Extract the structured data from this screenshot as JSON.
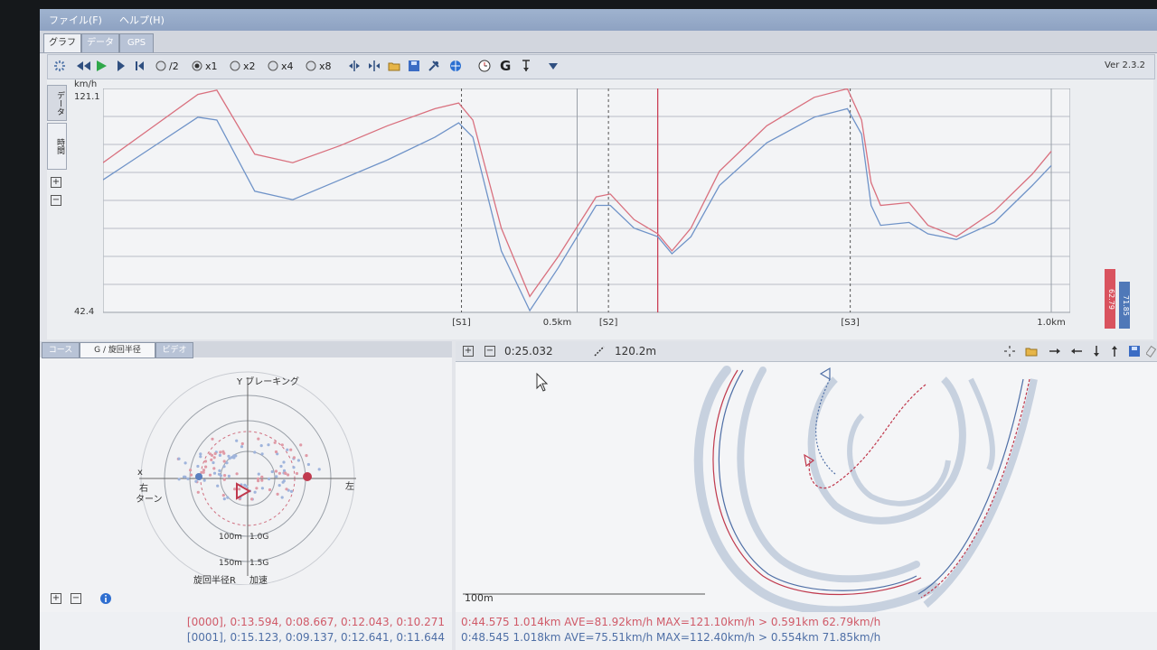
{
  "menu": {
    "file": "ファイル(F)",
    "help": "ヘルプ(H)"
  },
  "tabs": [
    "グラフ",
    "データ",
    "GPS"
  ],
  "toolbar": {
    "speed_half": "/2",
    "speed_x1": "x1",
    "speed_x2": "x2",
    "speed_x4": "x4",
    "speed_x8": "x8",
    "g_label": "G",
    "version": "Ver 2.3.2"
  },
  "graph": {
    "side_tabs": [
      "データ",
      "時間"
    ],
    "unit": "km/h",
    "y_max_label": "121.1",
    "y_min_label": "42.4"
  },
  "chart_data": {
    "type": "line",
    "ylabel": "km/h",
    "ylim": [
      42.4,
      121.1
    ],
    "xlim": [
      0,
      1.02
    ],
    "x_tick_labels": [
      {
        "x": 0.5,
        "label": "0.5km"
      },
      {
        "x": 1.0,
        "label": "1.0km"
      }
    ],
    "sector_markers": [
      {
        "x": 0.378,
        "label": "[S1]"
      },
      {
        "x": 0.533,
        "label": "[S2]"
      },
      {
        "x": 0.788,
        "label": "[S3]"
      }
    ],
    "cursor_x": 0.585,
    "series": [
      {
        "color": "#d9707e",
        "x": [
          0,
          0.05,
          0.1,
          0.12,
          0.16,
          0.2,
          0.25,
          0.3,
          0.35,
          0.375,
          0.39,
          0.42,
          0.45,
          0.48,
          0.52,
          0.535,
          0.56,
          0.585,
          0.6,
          0.62,
          0.65,
          0.7,
          0.75,
          0.785,
          0.8,
          0.81,
          0.82,
          0.85,
          0.87,
          0.9,
          0.94,
          0.98,
          1.0
        ],
        "y": [
          95,
          107,
          119,
          120.5,
          98,
          95,
          101,
          108,
          114,
          116,
          110,
          72,
          48,
          62,
          83,
          84,
          75,
          70,
          64,
          72,
          92,
          108,
          118,
          121,
          110,
          88,
          80,
          81,
          73,
          69,
          78,
          91,
          99
        ]
      },
      {
        "color": "#6f93c8",
        "x": [
          0,
          0.05,
          0.1,
          0.12,
          0.16,
          0.2,
          0.25,
          0.3,
          0.35,
          0.375,
          0.39,
          0.42,
          0.45,
          0.48,
          0.52,
          0.535,
          0.56,
          0.585,
          0.6,
          0.62,
          0.65,
          0.7,
          0.75,
          0.785,
          0.8,
          0.81,
          0.82,
          0.85,
          0.87,
          0.9,
          0.94,
          0.98,
          1.0
        ],
        "y": [
          89,
          100,
          111,
          110,
          85,
          82,
          89,
          96,
          104,
          109,
          104,
          64,
          43,
          58,
          80,
          80,
          72,
          69,
          63,
          69,
          87,
          102,
          111,
          114,
          105,
          80,
          73,
          74,
          70,
          68,
          74,
          87,
          94
        ]
      }
    ],
    "legend_values": [
      {
        "label": "62.79",
        "color": "#d9535f"
      },
      {
        "label": "71.85",
        "color": "#4f78b8"
      }
    ]
  },
  "g_panel": {
    "tabs": [
      "コース",
      "G / 旋回半径",
      "ビデオ"
    ],
    "y_label": "Y ブレーキング",
    "x_label": "x",
    "right_label": "右",
    "turn_label": "ターン",
    "left_label": "左",
    "r100_label": "100m",
    "g10_label": "1.0G",
    "r150_label": "150m",
    "g15_label": "1.5G",
    "radius_label": "旋回半径R",
    "accel_label": "加速"
  },
  "map_panel": {
    "time": "0:25.032",
    "distance": "120.2m",
    "scale_label": "100m"
  },
  "status": {
    "left_line1": "[0000], 0:13.594, 0:08.667, 0:12.043, 0:10.271",
    "left_line2": "[0001], 0:15.123, 0:09.137, 0:12.641, 0:11.644",
    "right_line1": "0:44.575 1.014km AVE=81.92km/h MAX=121.10km/h > 0.591km 62.79km/h",
    "right_line2": "0:48.545 1.018km AVE=75.51km/h MAX=112.40km/h > 0.554km 71.85km/h"
  }
}
